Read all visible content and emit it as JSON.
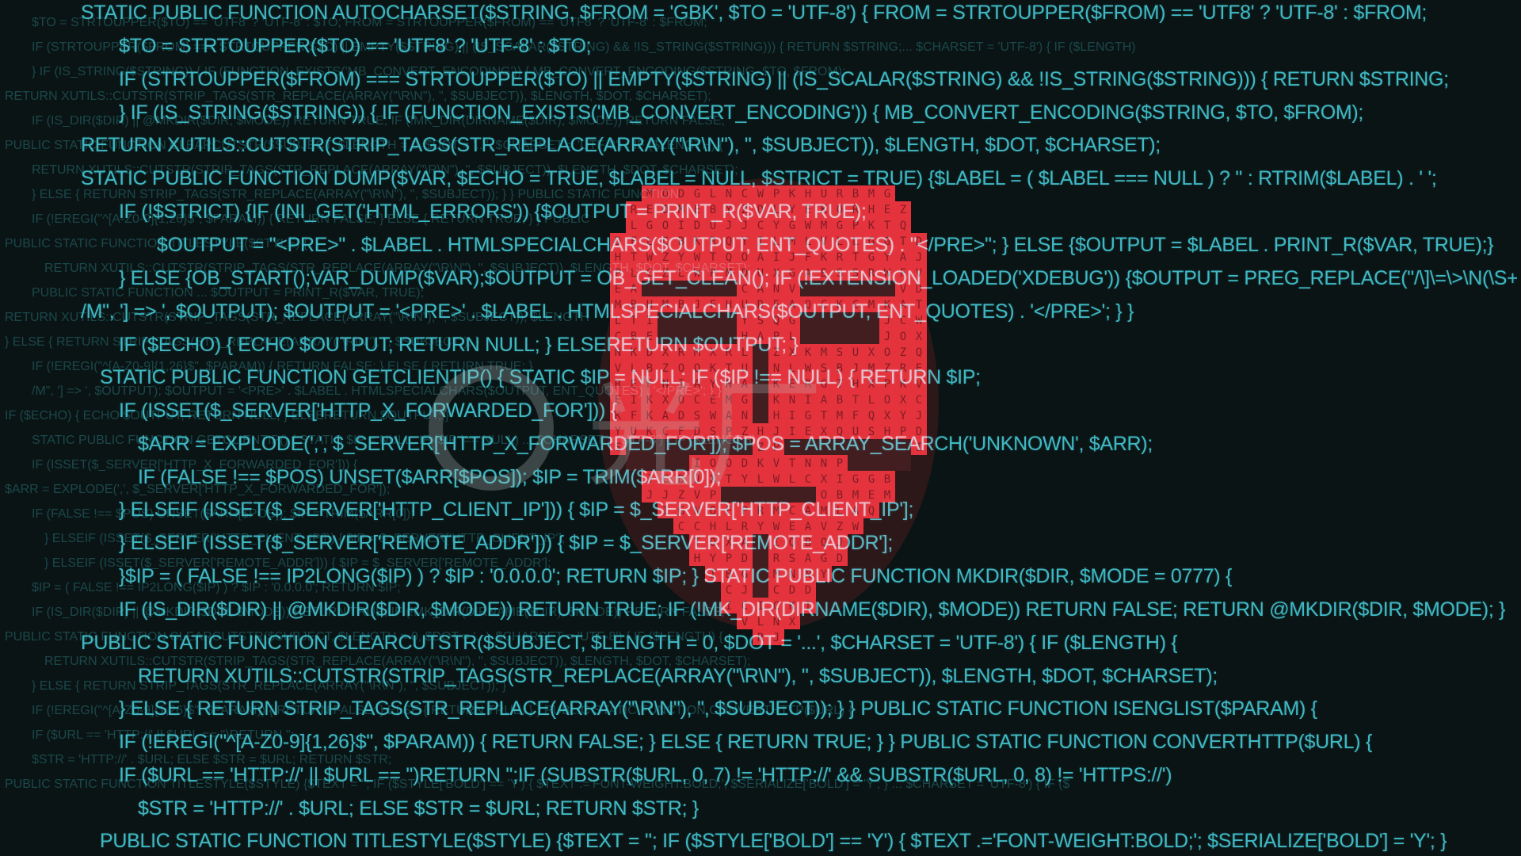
{
  "scene": {
    "description_tags": [
      "hacker-mask-icon",
      "code-background",
      "watermark"
    ],
    "colors": {
      "background": "#0b1414",
      "code_foreground": "#3fb8c4",
      "code_background": "#1c4e52",
      "mask_red": "#e3222c",
      "mask_dark": "#3a0b0d"
    }
  },
  "watermark": {
    "text": "光厂"
  },
  "foreground_code": [
    "STATIC PUBLIC FUNCTION AUTOCHARSET($STRING, $FROM = 'GBK', $TO = 'UTF-8') { FROM = STRTOUPPER($FROM) == 'UTF8' ? 'UTF-8' : $FROM;",
    "$TO = STRTOUPPER($TO) == 'UTF8' ? 'UTF-8' : $TO;",
    "IF (STRTOUPPER($FROM) === STRTOUPPER($TO) || EMPTY($STRING) || (IS_SCALAR($STRING) && !IS_STRING($STRING))) {  RETURN $STRING;",
    "}  IF (IS_STRING($STRING)) { IF (FUNCTION_EXISTS('MB_CONVERT_ENCODING')) {  MB_CONVERT_ENCODING($STRING, $TO, $FROM);",
    "RETURN XUTILS::CUTSTR(STRIP_TAGS(STR_REPLACE(ARRAY(\"\\R\\N\"), '', $SUBJECT)), $LENGTH, $DOT, $CHARSET);",
    "STATIC PUBLIC FUNCTION DUMP($VAR, $ECHO = TRUE, $LABEL = NULL, $STRICT = TRUE) {$LABEL = ( $LABEL === NULL ) ? '' : RTRIM($LABEL) . ' ';",
    "IF (!$STRICT) {IF (INI_GET('HTML_ERRORS')) {$OUTPUT = PRINT_R($VAR, TRUE);",
    "$OUTPUT = \"<PRE>\" . $LABEL . HTMLSPECIALCHARS($OUTPUT, ENT_QUOTES) . \"</PRE>\"; } ELSE {$OUTPUT = $LABEL . PRINT_R($VAR, TRUE);}",
    "} ELSE {OB_START();VAR_DUMP($VAR);$OUTPUT = OB_GET_CLEAN(); IF (!EXTENSION_LOADED('XDEBUG')) {$OUTPUT = PREG_REPLACE(\"/\\]\\=\\>\\N(\\S+)",
    "/M\", '] => ', $OUTPUT); $OUTPUT = '<PRE>' . $LABEL . HTMLSPECIALCHARS($OUTPUT, ENT_QUOTES) . '</PRE>'; } }",
    "IF ($ECHO) { ECHO $OUTPUT; RETURN NULL; } ELSERETURN $OUTPUT; }",
    "STATIC PUBLIC FUNCTION GETCLIENTIP() { STATIC $IP = NULL; IF ($IP !== NULL) { RETURN $IP;",
    "IF (ISSET($_SERVER['HTTP_X_FORWARDED_FOR'])) {",
    "$ARR = EXPLODE(',', $_SERVER['HTTP_X_FORWARDED_FOR']); $POS = ARRAY_SEARCH('UNKNOWN', $ARR);",
    "IF (FALSE !== $POS) UNSET($ARR[$POS]); $IP = TRIM($ARR[0]);",
    "} ELSEIF (ISSET($_SERVER['HTTP_CLIENT_IP'])) { $IP = $_SERVER['HTTP_CLIENT_IP'];",
    "} ELSEIF (ISSET($_SERVER['REMOTE_ADDR'])) { $IP = $_SERVER['REMOTE_ADDR'];",
    "}$IP = ( FALSE !== IP2LONG($IP) ) ? $IP : '0.0.0.0'; RETURN $IP; } STATIC PUBLIC FUNCTION MKDIR($DIR, $MODE = 0777) {",
    "IF (IS_DIR($DIR) || @MKDIR($DIR, $MODE)) RETURN TRUE; IF (!MK_DIR(DIRNAME($DIR), $MODE)) RETURN FALSE; RETURN @MKDIR($DIR, $MODE); }",
    "PUBLIC STATIC FUNCTION CLEARCUTSTR($SUBJECT, $LENGTH = 0, $DOT = '...', $CHARSET = 'UTF-8') { IF ($LENGTH) {",
    "RETURN XUTILS::CUTSTR(STRIP_TAGS(STR_REPLACE(ARRAY(\"\\R\\N\"), '', $SUBJECT)), $LENGTH, $DOT, $CHARSET);",
    "} ELSE { RETURN STRIP_TAGS(STR_REPLACE(ARRAY(\"\\R\\N\"), '', $SUBJECT)); } } PUBLIC STATIC FUNCTION ISENGLIST($PARAM) {",
    "IF (!EREGI(\"^[A-Z0-9]{1,26}$\", $PARAM)) { RETURN FALSE; } ELSE { RETURN TRUE; } } PUBLIC STATIC FUNCTION CONVERTHTTP($URL) {",
    "IF ($URL == 'HTTP://' || $URL == '')RETURN '';IF (SUBSTR($URL, 0, 7) != 'HTTP://' && SUBSTR($URL, 0, 8) != 'HTTPS://')",
    "$STR = 'HTTP://' . $URL; ELSE $STR = $URL; RETURN $STR; }",
    "PUBLIC STATIC FUNCTION TITLESTYLE($STYLE) {$TEXT = ''; IF ($STYLE['BOLD'] == 'Y') { $TEXT .='FONT-WEIGHT:BOLD;'; $SERIALIZE['BOLD'] = 'Y'; }"
  ],
  "background_code": [
    "$TO = STRTOUPPER($TO) == 'UTF8' ? 'UTF-8' : $TO; FROM = STRTOUPPER($FROM) == 'UTF8' ? 'UTF-8' : $FROM;",
    "IF (STRTOUPPER($FROM) === STRTOUPPER($TO) || EMPTY($STRING) || (IS_SCALAR($STRING) && !IS_STRING($STRING))) { RETURN $STRING;... $CHARSET = 'UTF-8') { IF ($LENGTH)",
    "} IF (IS_STRING($STRING)) { IF (FUNCTION_EXISTS('MB_CONVERT_ENCODING')) { MB_CONVERT_ENCODING($STRING, $TO, $FROM);",
    "RETURN XUTILS::CUTSTR(STRIP_TAGS(STR_REPLACE(ARRAY(\"\\R\\N\"), '', $SUBJECT)), $LENGTH, $DOT, $CHARSET);",
    "IF (IS_DIR($DIR) || @MKDIR($DIR, $MODE)) RETURN TRUE; IF (!MK_DIR(DIRNAME($DIR), $MODE)) RETURN FALSE;",
    "PUBLIC STATIC FUNCTION CLEARCUTSTR($SUBJECT, $LENGTH = 0, $DOT = '...', $CHARSET = 'UTF-8') { IF ($LENGTH) {",
    "RETURN XUTILS::CUTSTR(STRIP_TAGS(STR_REPLACE(ARRAY(\"\\R\\N\"), '', $SUBJECT)), $LENGTH, $DOT, $CHARSET);",
    "} ELSE { RETURN STRIP_TAGS(STR_REPLACE(ARRAY(\"\\R\\N\"), '', $SUBJECT)); } } PUBLIC STATIC FUNCTION",
    "IF (!EREGI(\"^[A-Z0-9]{1,26}$\", $PARAM)) { RETURN FALSE; } ELSE { RETURN TRUE; } } PUBLIC",
    "PUBLIC STATIC FUNCTION TITLESTYLE($STYLE) {",
    "RETURN XUTILS::CUTSTR(STRIP_TAGS(STR_REPLACE(ARRAY(\"\\R\\N\"), '', $SUBJECT)), $LENGTH, $DOT, $CHARSET);",
    "PUBLIC STATIC FUNCTION ... $OUTPUT = PRINT_R($VAR, TRUE);",
    "RETURN XUTILS::CUTSTR(STRIP_TAGS(STR_REPLACE(ARRAY(\"\\R\\N\"), '', $SUBJECT)), $LENGTH",
    "} ELSE { RETURN STRIP_TAGS(STR_REPLACE(ARRAY(\"\\R\\N\"), '', $SUBJECT)); }",
    "IF (!EREGI(\"^[A-Z0-9]{1,26}$\", $PARAM)) { RETURN FALSE; } ELSE { RETURN TRUE; }",
    "/M\", '] => ', $OUTPUT); $OUTPUT = '<PRE>' . $LABEL . HTMLSPECIALCHARS($OUTPUT, ENT_QUOTES) . '</PRE>'; } }",
    "IF ($ECHO) { ECHO $OUTPUT; RETURN NULL; } ELSERETURN $OUTPUT; }",
    "STATIC PUBLIC FUNCTION GETCLIENTIP() { STATIC $IP = NULL; IF ($IP !== NULL) ... $CHARSET = 'UTF-8') { IF ($LENGTH)",
    "IF (ISSET($_SERVER['HTTP_X_FORWARDED_FOR'])) {",
    "$ARR = EXPLODE(',', $_SERVER['HTTP_X_FORWARDED_FOR']);",
    "IF (FALSE !== $POS) UNSET($ARR[$POS]); $IP = TRIM($ARR[0]);",
    "} ELSEIF (ISSET($_SERVER['HTTP_CLIENT_IP'])) { $IP = $_SERVER['HTTP_CLIENT_IP'];",
    "} ELSEIF (ISSET($_SERVER['REMOTE_ADDR'])) { $IP = $_SERVER['REMOTE_ADDR'];",
    "$IP = ( FALSE !== IP2LONG($IP) ) ? $IP : '0.0.0.0'; RETURN $IP;",
    "IF (IS_DIR($DIR) || @MKDIR($DIR, $MODE)) RETURN TRUE; IF (!MK_DIR(DIRNAME($DIR), $MODE)) RETURN FALSE;",
    "PUBLIC STATIC FUNCTION CLEARCUTSTR($SUBJECT, $LENGTH = 0, $DOT = '...', $CHARSET = 'UTF-8') { IF ($LENGTH) {",
    "RETURN XUTILS::CUTSTR(STRIP_TAGS(STR_REPLACE(ARRAY(\"\\R\\N\"), '', $SUBJECT)), $LENGTH, $DOT, $CHARSET);",
    "} ELSE { RETURN STRIP_TAGS(STR_REPLACE(ARRAY(\"\\R\\N\"), '', $SUBJECT)); }",
    "IF (!EREGI(\"^[A-Z0-9]{1,26}$\", $PARAM)) { RETURN FALSE; } ELSE { RETURN TRUE; } } PUBLIC STATIC FUNCTION CONVERTHTTP($URL) {",
    "IF ($URL == 'HTTP://' || $URL == '')RETURN '';",
    "$STR = 'HTTP://' . $URL; ELSE $STR = $URL; RETURN $STR;",
    "PUBLIC STATIC FUNCTION TITLESTYLE($STYLE) {$TEXT = ''; IF ($STYLE['BOLD'] == 'Y') { $TEXT .='FONT-WEIGHT:BOLD;'; $SERIALIZE['BOLD'] = 'Y'; } ... $CHARSET = 'UTF-8') { IF ($"
  ]
}
